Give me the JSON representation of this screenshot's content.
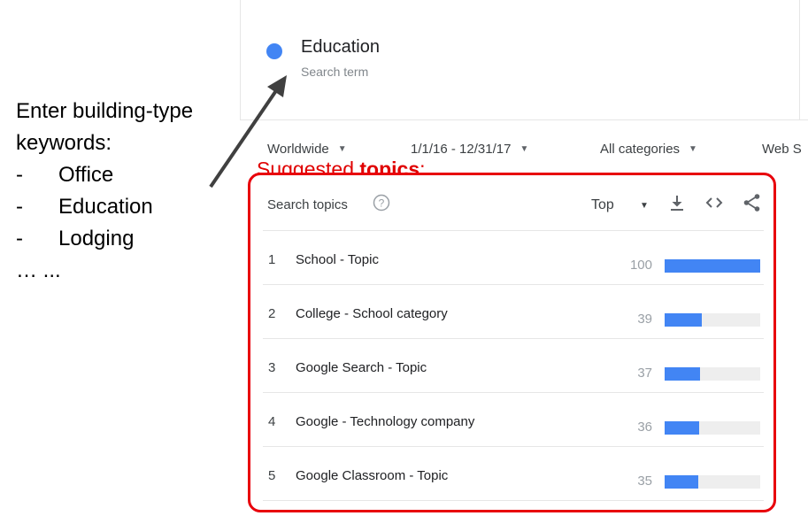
{
  "annotation": {
    "heading_line1": "Enter building-type",
    "heading_line2": "keywords:",
    "items": [
      {
        "dash": "-",
        "text": "Office"
      },
      {
        "dash": "-",
        "text": "Education"
      },
      {
        "dash": "-",
        "text": "Lodging"
      }
    ],
    "ellipsis": "… ..."
  },
  "search_term": {
    "name": "Education",
    "subtitle": "Search term",
    "color": "#4285f4"
  },
  "filters": {
    "region": "Worldwide",
    "date_range": "1/1/16 - 12/31/17",
    "category": "All categories",
    "search_type": "Web S"
  },
  "suggested": {
    "prefix": "Suggested ",
    "bold": "topics",
    "suffix": ":"
  },
  "panel": {
    "title": "Search topics",
    "sort": "Top",
    "icons": [
      "help-icon",
      "download-icon",
      "embed-icon",
      "share-icon"
    ],
    "rows": [
      {
        "rank": "1",
        "topic": "School - Topic",
        "value": "100",
        "score": 100
      },
      {
        "rank": "2",
        "topic": "College - School category",
        "value": "39",
        "score": 39
      },
      {
        "rank": "3",
        "topic": "Google Search - Topic",
        "value": "37",
        "score": 37
      },
      {
        "rank": "4",
        "topic": "Google - Technology company",
        "value": "36",
        "score": 36
      },
      {
        "rank": "5",
        "topic": "Google Classroom - Topic",
        "value": "35",
        "score": 35
      }
    ]
  },
  "colors": {
    "accent": "#4285f4",
    "highlight": "#e8000b"
  }
}
